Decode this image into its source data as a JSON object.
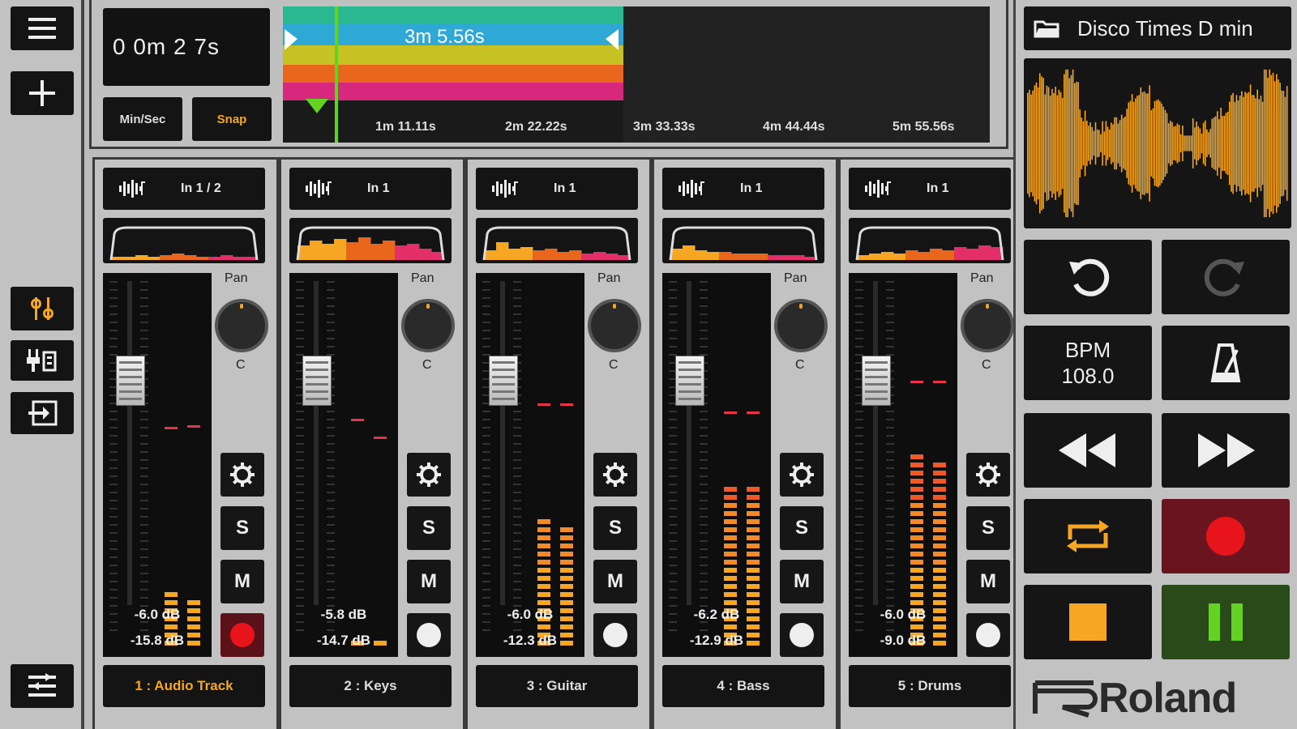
{
  "transport_time": {
    "display": "0 0m 2 7s",
    "loop_length": "3m 5.56s"
  },
  "toolbar": {
    "minsec_label": "Min/Sec",
    "snap_label": "Snap"
  },
  "timeline": {
    "ticks": [
      "1m 11.11s",
      "2m 22.22s",
      "3m 33.33s",
      "4m 44.44s",
      "5m 55.56s"
    ],
    "lane_colors": [
      "#2ab890",
      "#2ea9d6",
      "#c6c223",
      "#e8671c",
      "#d8287e"
    ]
  },
  "tracks": [
    {
      "input": "In 1 / 2",
      "pan_label": "Pan",
      "pan_value": "C",
      "fader_db": "-6.0 dB",
      "peak_db": "-15.8 dB",
      "name": "1 : Audio Track",
      "selected": true,
      "record_armed": true,
      "solo": "S",
      "mute": "M"
    },
    {
      "input": "In 1",
      "pan_label": "Pan",
      "pan_value": "C",
      "fader_db": "-5.8 dB",
      "peak_db": "-14.7 dB",
      "name": "2 : Keys",
      "selected": false,
      "record_armed": false,
      "solo": "S",
      "mute": "M"
    },
    {
      "input": "In 1",
      "pan_label": "Pan",
      "pan_value": "C",
      "fader_db": "-6.0 dB",
      "peak_db": "-12.3 dB",
      "name": "3 : Guitar",
      "selected": false,
      "record_armed": false,
      "solo": "S",
      "mute": "M"
    },
    {
      "input": "In 1",
      "pan_label": "Pan",
      "pan_value": "C",
      "fader_db": "-6.2 dB",
      "peak_db": "-12.9 dB",
      "name": "4 : Bass",
      "selected": false,
      "record_armed": false,
      "solo": "S",
      "mute": "M"
    },
    {
      "input": "In 1",
      "pan_label": "Pan",
      "pan_value": "C",
      "fader_db": "-6.0 dB",
      "peak_db": "-9.0 dB",
      "name": "5 : Drums",
      "selected": false,
      "record_armed": false,
      "solo": "S",
      "mute": "M"
    }
  ],
  "right_panel": {
    "song_title": "Disco Times D min",
    "bpm_label": "BPM",
    "bpm_value": "108.0",
    "brand": "Roland"
  },
  "colors": {
    "accent": "#f5a623",
    "record": "#e8141b",
    "play": "#63d223"
  }
}
